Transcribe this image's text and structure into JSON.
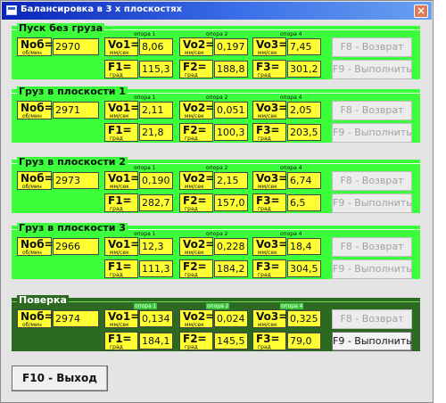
{
  "window": {
    "title": "Балансировка в 3 х плоскостях",
    "close_label": "×"
  },
  "labels": {
    "n": "Nоб=",
    "n_unit": "об/мин",
    "vo1": "Vo1=",
    "vo2": "Vo2=",
    "vo3": "Vo3=",
    "v_unit": "мм/сек",
    "f1": "F1=",
    "f2": "F2=",
    "f3": "F3=",
    "f_unit": "град",
    "support1": "опора 1",
    "support2": "опора 2",
    "support4": "опора 4"
  },
  "buttons": {
    "f8": "F8 - Возврат",
    "f9": "F9 - Выполнить",
    "f10": "F10 - Выход"
  },
  "panels": [
    {
      "title": "Пуск без груза",
      "n": "2970",
      "vo1": "8,06",
      "vo2": "0,197",
      "vo3": "7,45",
      "f1": "115,3",
      "f2": "188,8",
      "f3": "301,2"
    },
    {
      "title": "Груз в плоскости 1",
      "n": "2971",
      "vo1": "2,11",
      "vo2": "0,051",
      "vo3": "2,05",
      "f1": "21,8",
      "f2": "100,3",
      "f3": "203,5"
    },
    {
      "title": "Груз в плоскости 2",
      "n": "2973",
      "vo1": "0,190",
      "vo2": "2,15",
      "vo3": "6,74",
      "f1": "282,7",
      "f2": "157,0",
      "f3": "6,5"
    },
    {
      "title": "Груз в плоскости 3",
      "n": "2966",
      "vo1": "12,3",
      "vo2": "0,228",
      "vo3": "18,4",
      "f1": "111,3",
      "f2": "184,2",
      "f3": "304,5"
    },
    {
      "title": "Поверка",
      "n": "2974",
      "vo1": "0,134",
      "vo2": "0,024",
      "vo3": "0,325",
      "f1": "184,1",
      "f2": "145,5",
      "f3": "79,0"
    }
  ]
}
